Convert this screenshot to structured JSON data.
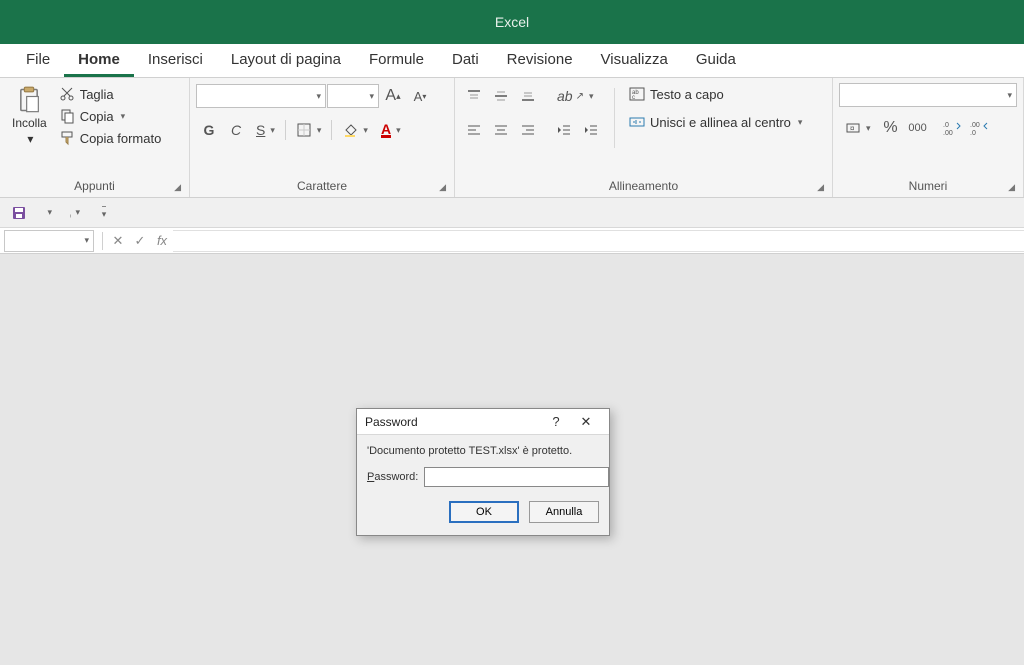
{
  "title": "Excel",
  "tabs": [
    "File",
    "Home",
    "Inserisci",
    "Layout di pagina",
    "Formule",
    "Dati",
    "Revisione",
    "Visualizza",
    "Guida"
  ],
  "active_tab": 1,
  "clipboard": {
    "paste": "Incolla",
    "cut": "Taglia",
    "copy": "Copia",
    "format_painter": "Copia formato",
    "label": "Appunti"
  },
  "font": {
    "increase": "A",
    "decrease": "A",
    "bold": "G",
    "italic": "C",
    "underline": "S",
    "label": "Carattere"
  },
  "alignment": {
    "wrap": "Testo a capo",
    "merge": "Unisci e allinea al centro",
    "label": "Allineamento"
  },
  "number": {
    "thousands": "000",
    "label": "Numeri"
  },
  "dialog": {
    "title": "Password",
    "message": "'Documento protetto TEST.xlsx' è protetto.",
    "field_label_pre": "P",
    "field_label_rest": "assword:",
    "ok": "OK",
    "cancel": "Annulla"
  }
}
